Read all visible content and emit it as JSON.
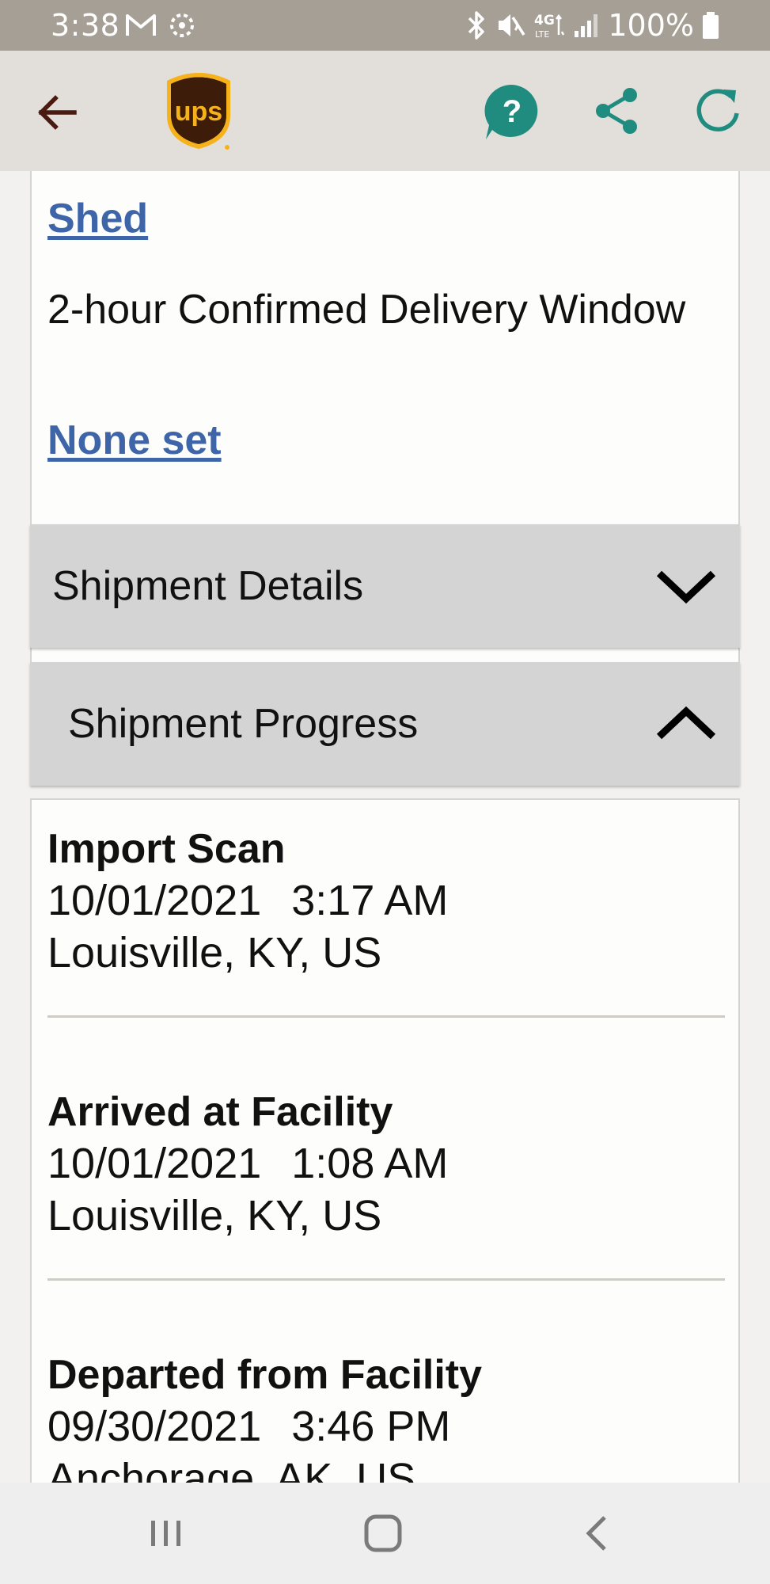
{
  "status_bar": {
    "time": "3:38",
    "battery_text": "100%",
    "icons": [
      "gmail-icon",
      "sync-icon",
      "bluetooth-icon",
      "mute-icon",
      "4g-lte-icon",
      "signal-icon",
      "battery-icon"
    ]
  },
  "app_bar": {
    "logo_text": "ups",
    "icons": [
      "back-arrow-icon",
      "ups-logo",
      "help-icon",
      "share-icon",
      "refresh-icon"
    ],
    "colors": {
      "accent": "#1f8c7f",
      "back": "#4a1a10",
      "brand_brown": "#3d1c0a",
      "brand_gold": "#f6b21b"
    }
  },
  "delivery_card": {
    "shed_link": "Shed",
    "window_label": "2-hour Confirmed Delivery Window",
    "none_set_link": "None set",
    "link_color": "#3f65a9"
  },
  "sections": {
    "details": {
      "label": "Shipment Details",
      "state": "collapsed"
    },
    "progress": {
      "label": "Shipment Progress",
      "state": "expanded"
    }
  },
  "progress_events": [
    {
      "title": "Import Scan",
      "date": "10/01/2021",
      "time": "3:17 AM",
      "location": "Louisville, KY, US"
    },
    {
      "title": "Arrived at Facility",
      "date": "10/01/2021",
      "time": "1:08 AM",
      "location": "Louisville, KY, US"
    },
    {
      "title": "Departed from Facility",
      "date": "09/30/2021",
      "time": "3:46 PM",
      "location": "Anchorage, AK, US"
    }
  ],
  "nav_bar": {
    "buttons": [
      "recents-icon",
      "home-icon",
      "back-icon"
    ]
  }
}
